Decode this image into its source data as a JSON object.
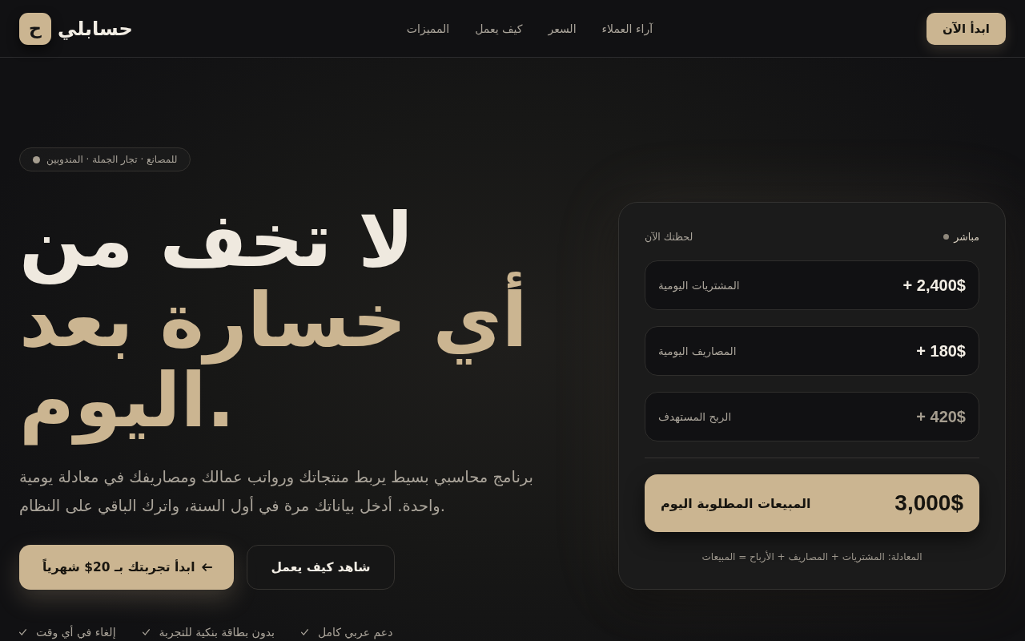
{
  "header": {
    "logo": {
      "mark": "ح",
      "name": "حسابلي"
    },
    "nav": [
      "آراء العملاء",
      "السعر",
      "كيف يعمل",
      "المميزات"
    ],
    "cta": "ابدأ الآن"
  },
  "hero": {
    "badge": "للمصانع · تجار الجملة · المندوبين",
    "headline": {
      "line_1": "لا تخف من",
      "line_2": "أي خسارة بعد اليوم."
    },
    "description": "برنامج محاسبي بسيط يربط منتجاتك ورواتب عمالك ومصاريفك في معادلة يومية واحدة. أدخل بياناتك مرة في أول السنة، واترك الباقي على النظام.",
    "buttons": [
      {
        "label": "شاهد كيف يعمل",
        "kind": "secondary"
      },
      {
        "label": "ابدأ تجربتك بـ 20$ شهرياً",
        "kind": "primary"
      }
    ],
    "perks": [
      "دعم عربي كامل",
      "بدون بطاقة بنكية للتجربة",
      "إلغاء في أي وقت"
    ]
  },
  "card": {
    "title": "لحظتك الآن",
    "status": "مباشر",
    "rows": [
      {
        "label": "المشتريات اليومية",
        "value": "+ 2,400$",
        "muted": false
      },
      {
        "label": "المصاريف اليومية",
        "value": "+ 180$",
        "muted": false
      },
      {
        "label": "الربح المستهدف",
        "value": "+ 420$",
        "muted": true
      }
    ],
    "total": {
      "label": "المبيعات المطلوبة اليوم",
      "value": "3,000$"
    },
    "formula": "المعادلة: المشتريات + المصاريف + الأرباح = المبيعات"
  }
}
